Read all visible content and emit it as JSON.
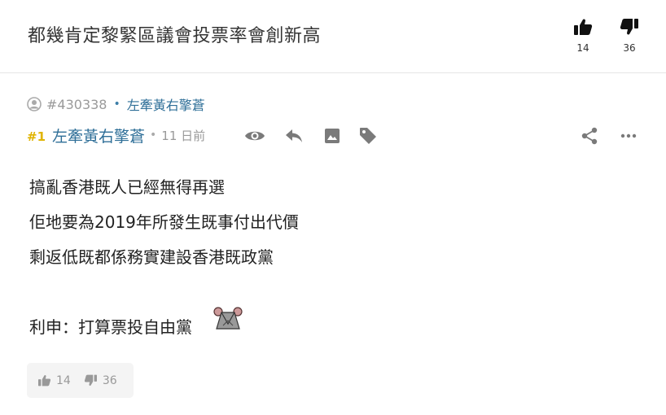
{
  "thread": {
    "title": "都幾肯定黎緊區議會投票率會創新高",
    "like_count": "14",
    "dislike_count": "36"
  },
  "post": {
    "thread_id": "#430338",
    "op_name": "左牽黃右擎蒼",
    "floor": "#1",
    "author": "左牽黃右擎蒼",
    "age": "11 日前",
    "lines": [
      "搞亂香港既人已經無得再選",
      "佢地要為2019年所發生既事付出代價",
      "剩返低既都係務實建設香港既政黨",
      "",
      "利申：打算票投自由黨"
    ],
    "like_count": "14",
    "dislike_count": "36"
  },
  "colors": {
    "author_link": "#2f6f98",
    "floor_tag": "#e0b400",
    "icon_grey": "#7a7a7a"
  },
  "icons": [
    "thumbs-up-icon",
    "thumbs-down-icon",
    "user-icon",
    "eye-icon",
    "reply-icon",
    "image-icon",
    "tag-icon",
    "share-icon",
    "more-icon",
    "sticker-emoji"
  ]
}
